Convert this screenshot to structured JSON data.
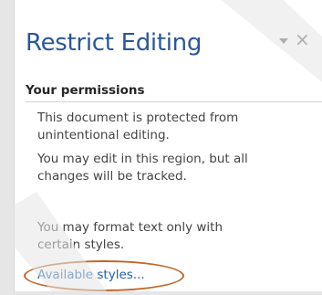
{
  "pane": {
    "title": "Restrict Editing",
    "menu_icon": "chevron-down-icon",
    "close_icon": "close-icon",
    "close_glyph": "×"
  },
  "permissions": {
    "header": "Your permissions",
    "protected_text": "This document is protected from\nunintentional editing.",
    "edit_region_text": "You may edit in this region, but all\nchanges will be tracked.",
    "format_text": "You may format text only with\ncertain styles.",
    "styles_link": "Available styles..."
  },
  "colors": {
    "title": "#2b579a",
    "link": "#1f5fa8",
    "highlight_ellipse": "#c0682b",
    "watermark": "#e6e6e6"
  }
}
